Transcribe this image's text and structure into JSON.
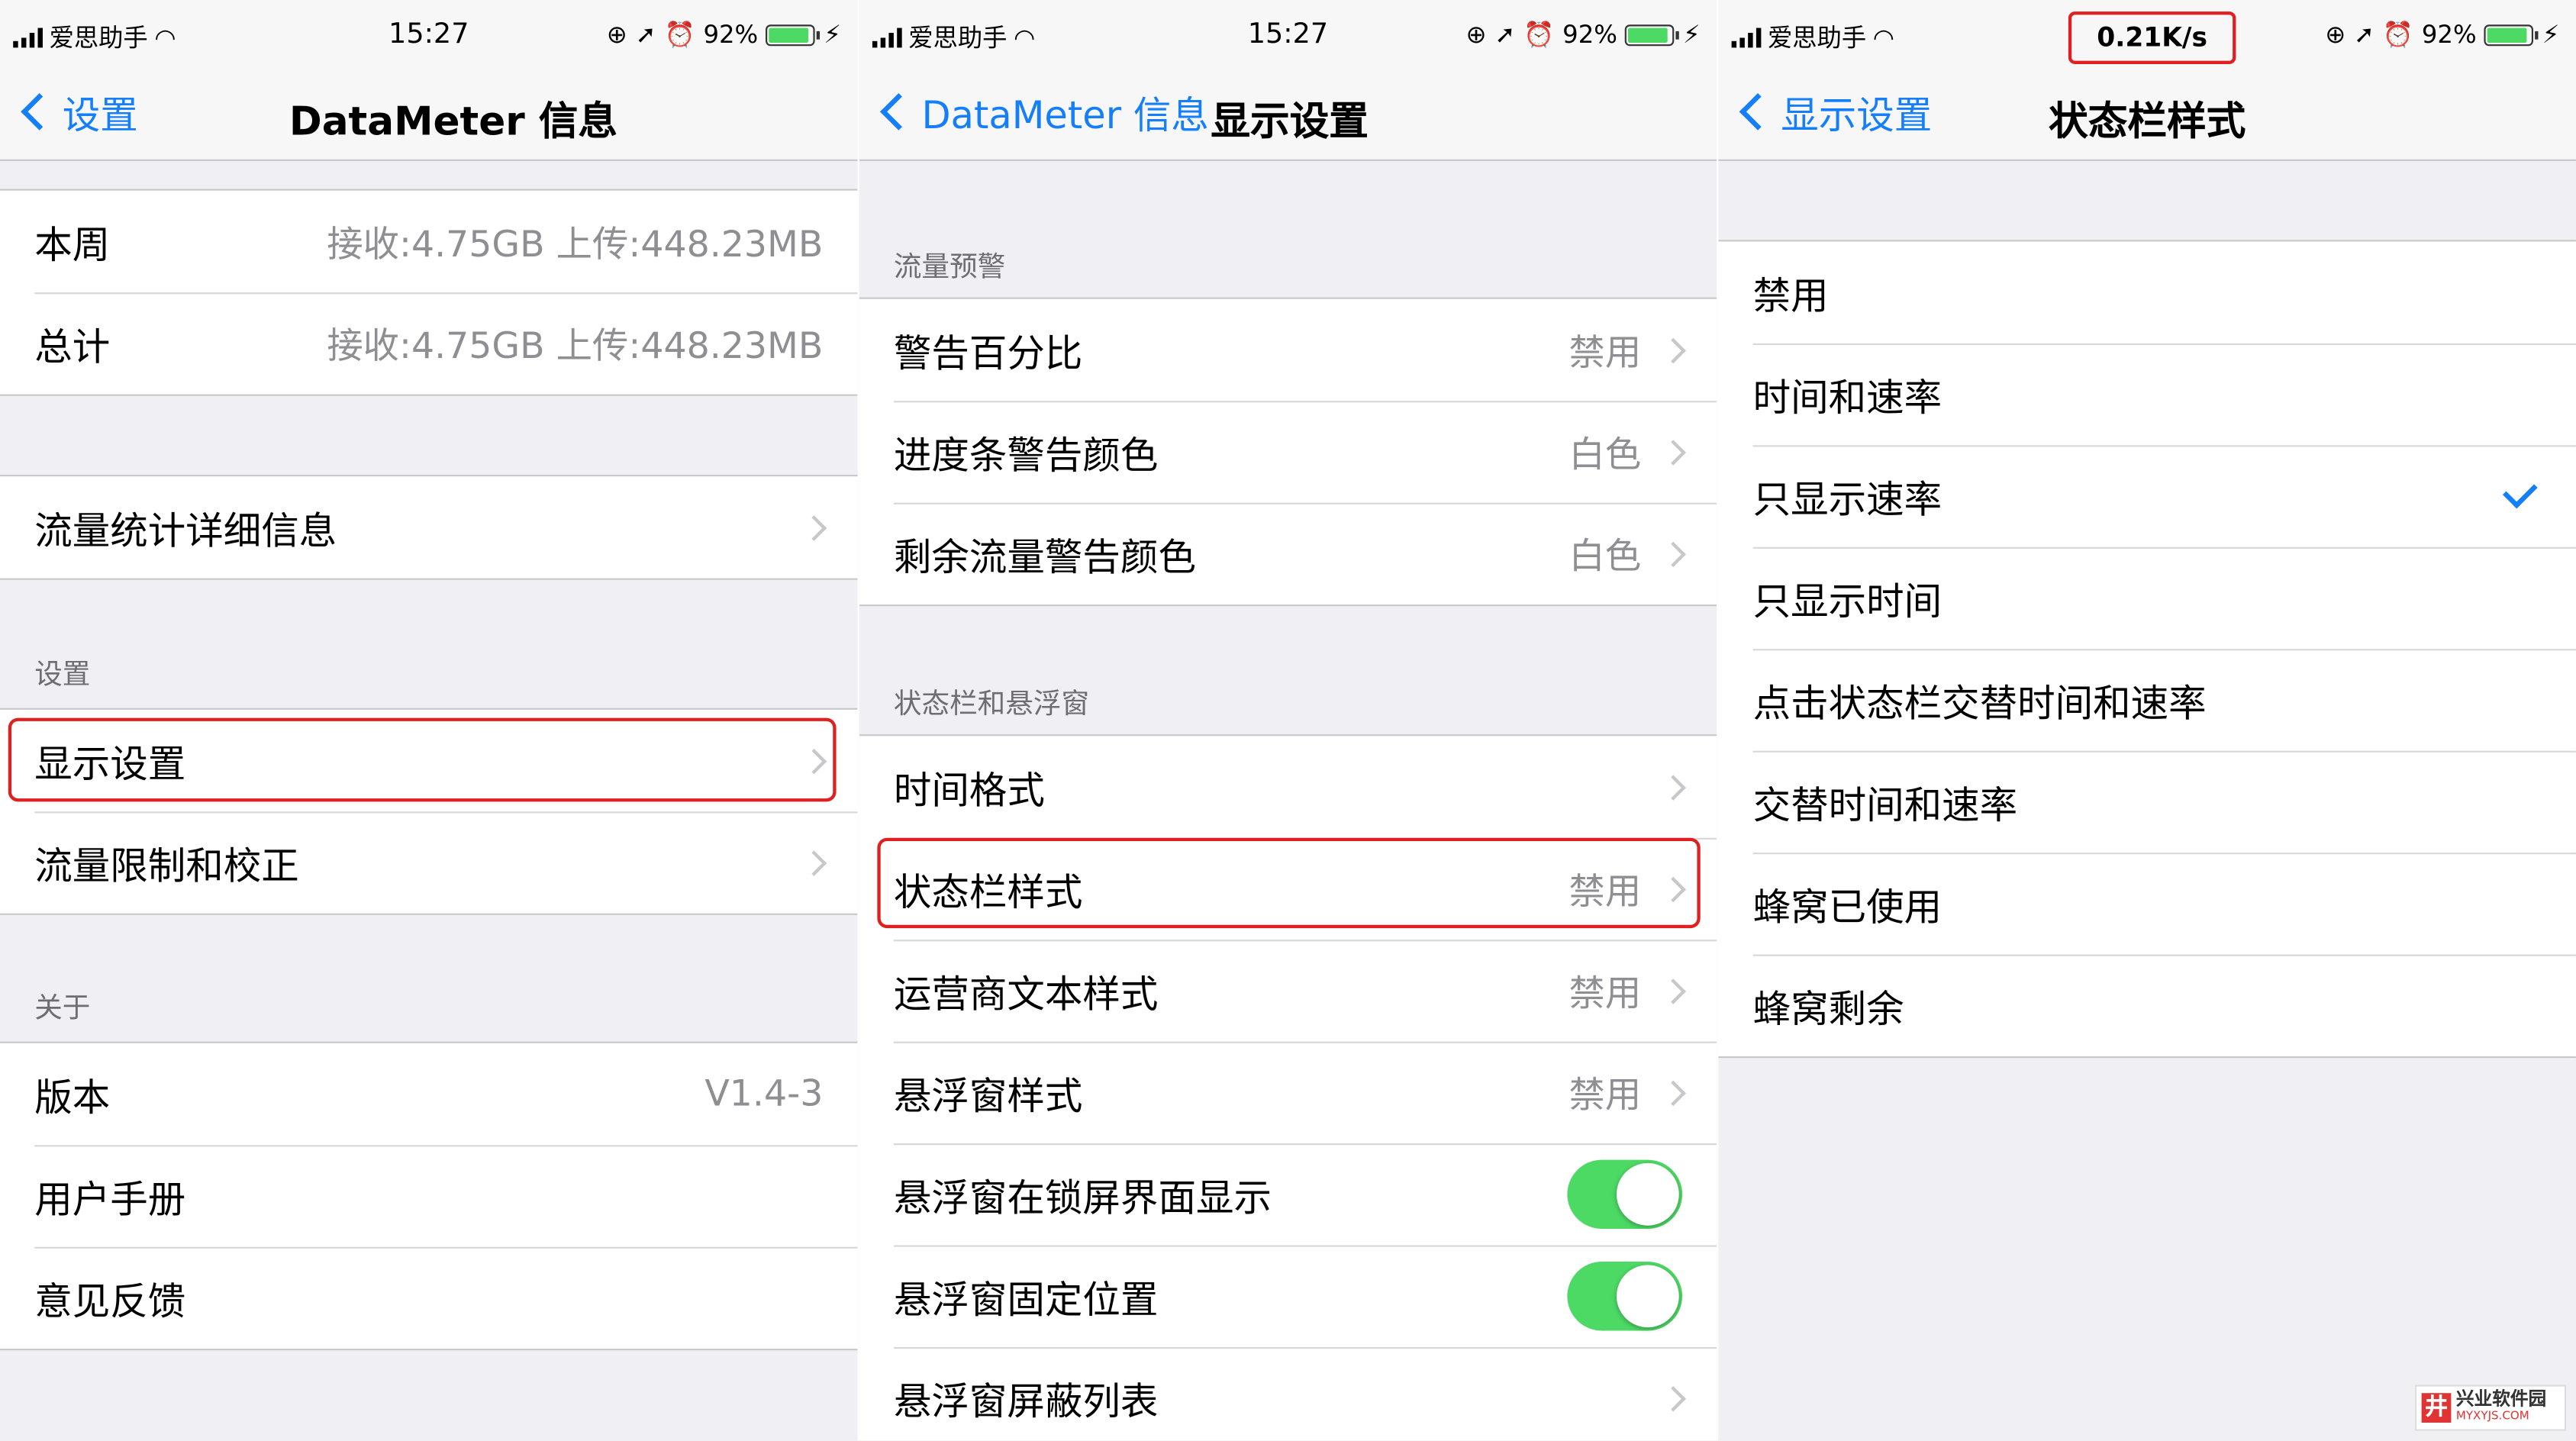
{
  "status_bar": {
    "carrier": "爱思助手",
    "time": "15:27",
    "battery": "92%",
    "speed_readout": "0.21K/s"
  },
  "panel1": {
    "back_label": "设置",
    "title": "DataMeter 信息",
    "usage_rows": [
      {
        "label": "本周",
        "value": "接收:4.75GB 上传:448.23MB"
      },
      {
        "label": "总计",
        "value": "接收:4.75GB 上传:448.23MB"
      }
    ],
    "detail_row": "流量统计详细信息",
    "settings_header": "设置",
    "settings_rows": [
      "显示设置",
      "流量限制和校正"
    ],
    "about_header": "关于",
    "version_label": "版本",
    "version_value": "V1.4-3",
    "about_rows": [
      "用户手册",
      "意见反馈"
    ]
  },
  "panel2": {
    "back_label": "DataMeter 信息",
    "title": "显示设置",
    "warning_header": "流量预警",
    "warning_rows": [
      {
        "label": "警告百分比",
        "value": "禁用"
      },
      {
        "label": "进度条警告颜色",
        "value": "白色"
      },
      {
        "label": "剩余流量警告颜色",
        "value": "白色"
      }
    ],
    "statusbar_header": "状态栏和悬浮窗",
    "statusbar_rows": [
      {
        "label": "时间格式",
        "value": ""
      },
      {
        "label": "状态栏样式",
        "value": "禁用"
      },
      {
        "label": "运营商文本样式",
        "value": "禁用"
      },
      {
        "label": "悬浮窗样式",
        "value": "禁用"
      }
    ],
    "toggle_rows": [
      {
        "label": "悬浮窗在锁屏界面显示",
        "on": true
      },
      {
        "label": "悬浮窗固定位置",
        "on": true
      }
    ],
    "blocklist_row": "悬浮窗屏蔽列表"
  },
  "panel3": {
    "back_label": "显示设置",
    "title": "状态栏样式",
    "options": [
      "禁用",
      "时间和速率",
      "只显示速率",
      "只显示时间",
      "点击状态栏交替时间和速率",
      "交替时间和速率",
      "蜂窝已使用",
      "蜂窝剩余"
    ],
    "selected_index": 2
  },
  "watermark": {
    "name": "兴业软件园",
    "url": "MYXYJS.COM"
  },
  "colors": {
    "accent": "#157efb",
    "highlight": "#e02020",
    "toggle_on": "#4cd964",
    "background": "#efeff4"
  }
}
